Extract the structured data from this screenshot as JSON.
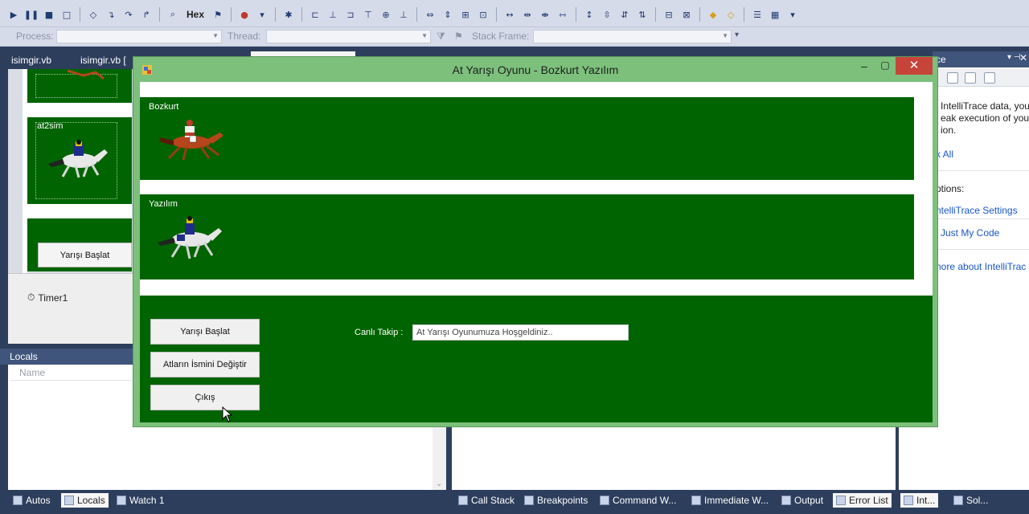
{
  "ide": {
    "toolbar": {
      "hex_label": "Hex",
      "process_label": "Process:",
      "thread_label": "Thread:",
      "stack_frame_label": "Stack Frame:"
    },
    "doc_tabs": [
      "isimgir.vb",
      "isimgir.vb ["
    ],
    "designer": {
      "horse_label": "at2sim",
      "button_label": "Yarışı Başlat",
      "timer_label": "Timer1"
    },
    "locals": {
      "title": "Locals",
      "column_name": "Name"
    },
    "intellitrace": {
      "title": "ce",
      "lines": [
        "IntelliTrace data, you",
        "eak execution of you",
        "ion."
      ],
      "link_break_all": "k All",
      "options_label": "ptions:",
      "link_settings": "ntelliTrace Settings",
      "link_just_my_code": "Just My Code",
      "link_more": "nore about IntelliTrac"
    },
    "bottom_tabs": {
      "autos": "Autos",
      "locals": "Locals",
      "watch": "Watch 1",
      "call_stack": "Call Stack",
      "breakpoints": "Breakpoints",
      "command": "Command W...",
      "immediate": "Immediate W...",
      "output": "Output",
      "error_list": "Error List",
      "int": "Int...",
      "sol": "Sol..."
    }
  },
  "app": {
    "title": "At Yarışı Oyunu - Bozkurt Yazılım",
    "tracks": [
      {
        "label": "Bozkurt"
      },
      {
        "label": "Yazılım"
      }
    ],
    "buttons": {
      "start": "Yarışı Başlat",
      "rename": "Atların İsmini Değiştir",
      "exit": "Çıkış"
    },
    "live_label": "Canlı Takip :",
    "live_value": "At Yarışı Oyunumuza Hoşgeldiniz..",
    "colors": {
      "track_green": "#006400",
      "window_border": "#7cc07c",
      "close_red": "#c7443a"
    }
  }
}
